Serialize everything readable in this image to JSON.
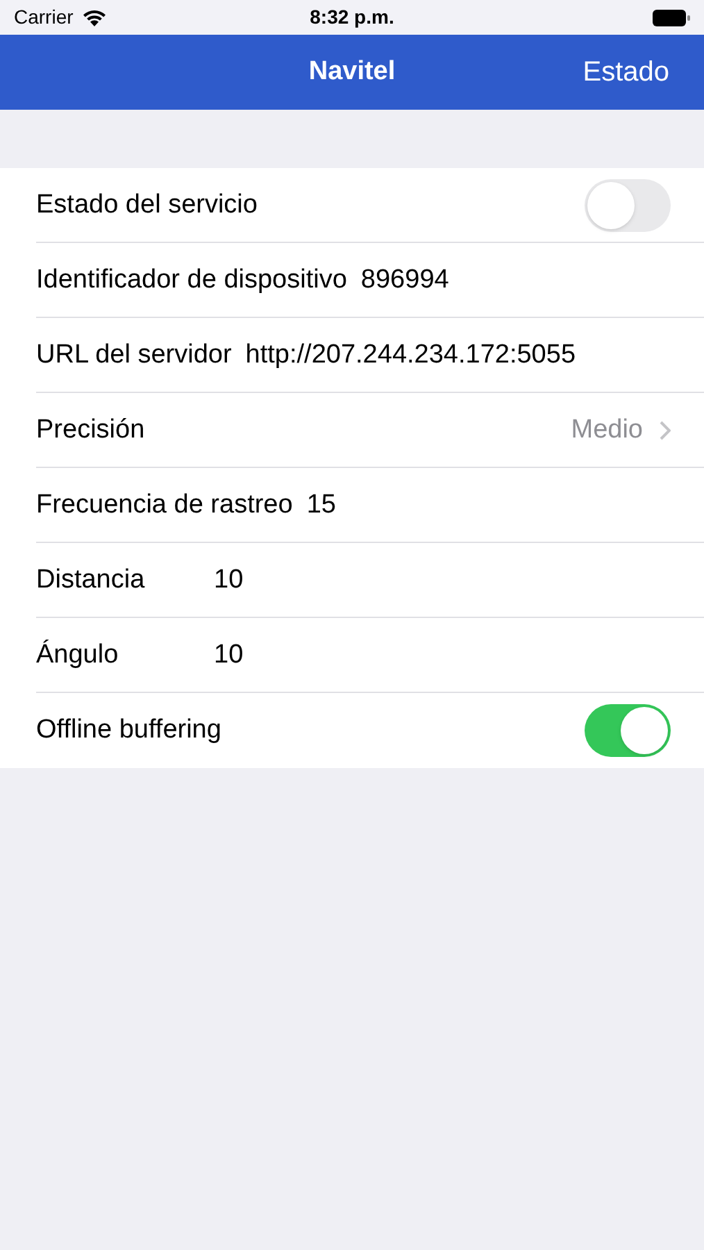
{
  "status_bar": {
    "carrier": "Carrier",
    "time": "8:32 p.m."
  },
  "nav_bar": {
    "title": "Navitel",
    "right_button": "Estado"
  },
  "rows": [
    {
      "kind": "toggle",
      "label": "Estado del servicio",
      "on": false
    },
    {
      "kind": "field",
      "label": "Identificador de dispositivo",
      "value": "896994"
    },
    {
      "kind": "field",
      "label": "URL del servidor",
      "value": "http://207.244.234.172:5055"
    },
    {
      "kind": "detail",
      "label": "Precisión",
      "value": "Medio"
    },
    {
      "kind": "field",
      "label": "Frecuencia de rastreo",
      "value": "15"
    },
    {
      "kind": "field",
      "label": "Distancia",
      "value": "10"
    },
    {
      "kind": "field",
      "label": "Ángulo",
      "value": "10"
    },
    {
      "kind": "toggle",
      "label": "Offline buffering",
      "on": true
    }
  ]
}
